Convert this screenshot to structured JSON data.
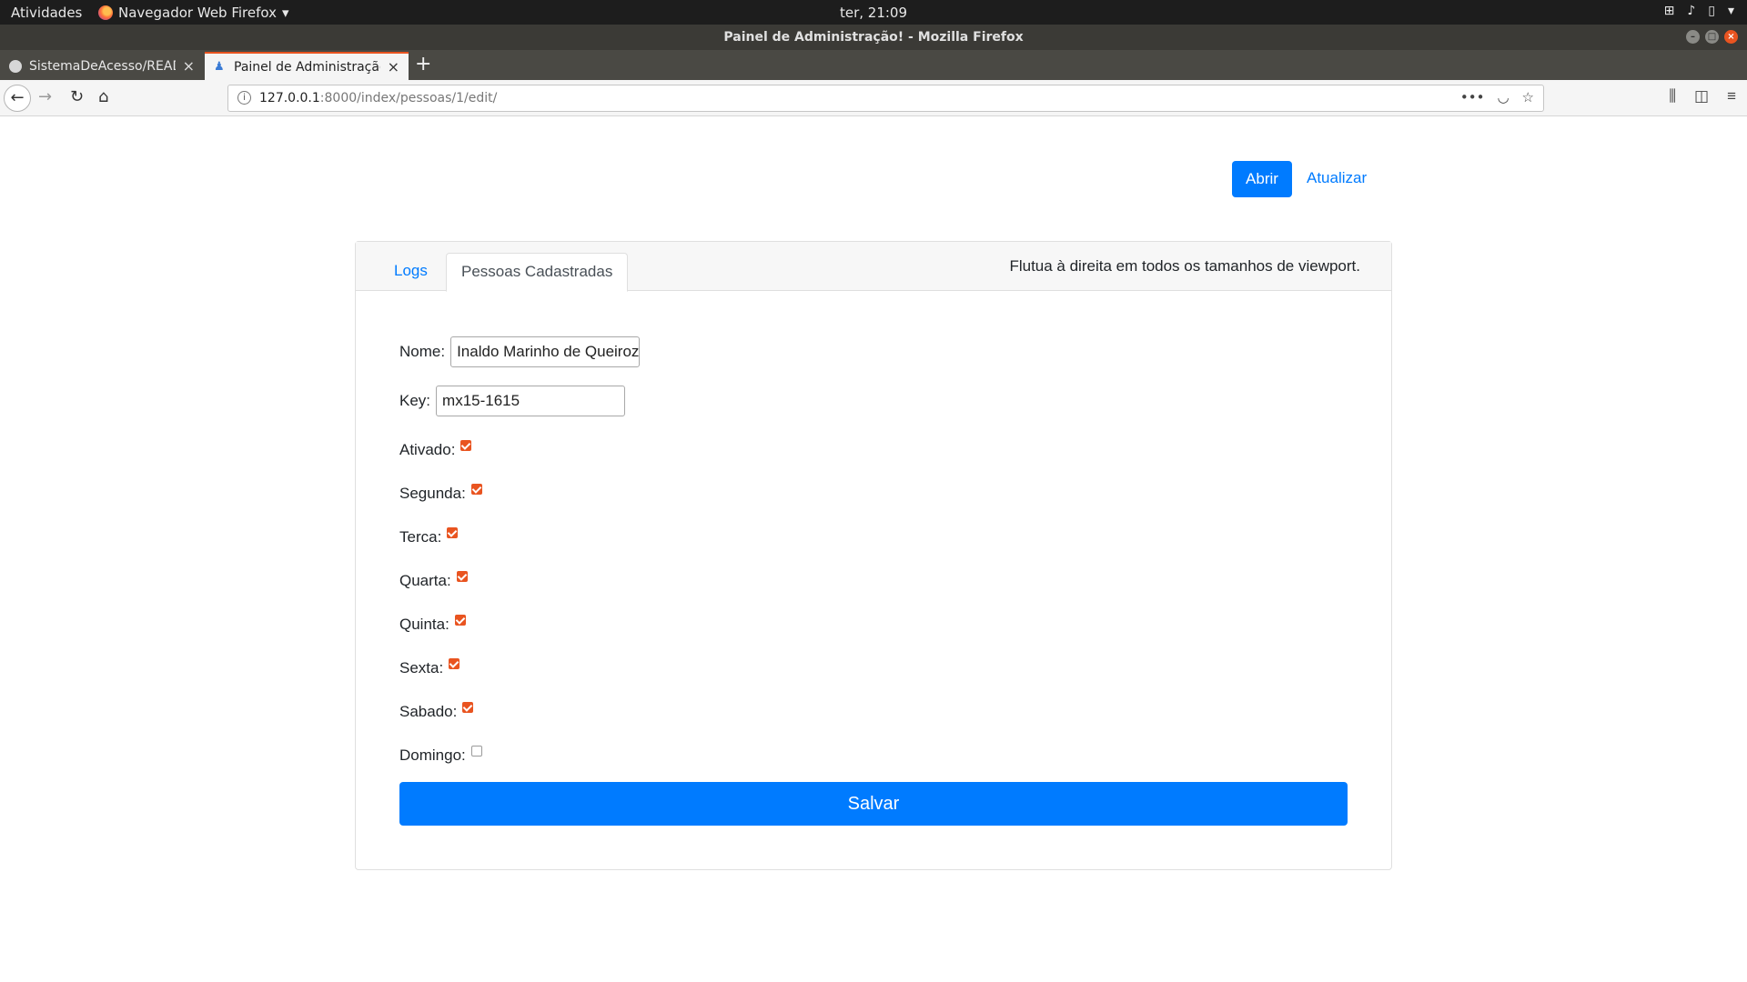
{
  "system": {
    "activities": "Atividades",
    "app_menu": "Navegador Web Firefox",
    "clock": "ter, 21:09"
  },
  "window": {
    "title": "Painel de Administração! - Mozilla Firefox"
  },
  "browser": {
    "tabs": [
      {
        "label": "SistemaDeAcesso/READM"
      },
      {
        "label": "Painel de Administração"
      }
    ],
    "url_host": "127.0.0.1",
    "url_rest": ":8000/index/pessoas/1/edit/"
  },
  "header": {
    "abrir_label": "Abrir",
    "atualizar_label": "Atualizar"
  },
  "card": {
    "tabs": [
      {
        "label": "Logs"
      },
      {
        "label": "Pessoas Cadastradas"
      }
    ],
    "float_text": "Flutua à direita em todos os tamanhos de viewport."
  },
  "form": {
    "nome_label": "Nome:",
    "nome_value": "Inaldo Marinho de Queiroz F",
    "key_label": "Key:",
    "key_value": "mx15-1615",
    "checkboxes": [
      {
        "label": "Ativado:",
        "checked": true
      },
      {
        "label": "Segunda:",
        "checked": true
      },
      {
        "label": "Terca:",
        "checked": true
      },
      {
        "label": "Quarta:",
        "checked": true
      },
      {
        "label": "Quinta:",
        "checked": true
      },
      {
        "label": "Sexta:",
        "checked": true
      },
      {
        "label": "Sabado:",
        "checked": true
      },
      {
        "label": "Domingo:",
        "checked": false
      }
    ],
    "submit_label": "Salvar"
  },
  "colors": {
    "primary": "#007bff",
    "checkbox_accent": "#e95420"
  }
}
